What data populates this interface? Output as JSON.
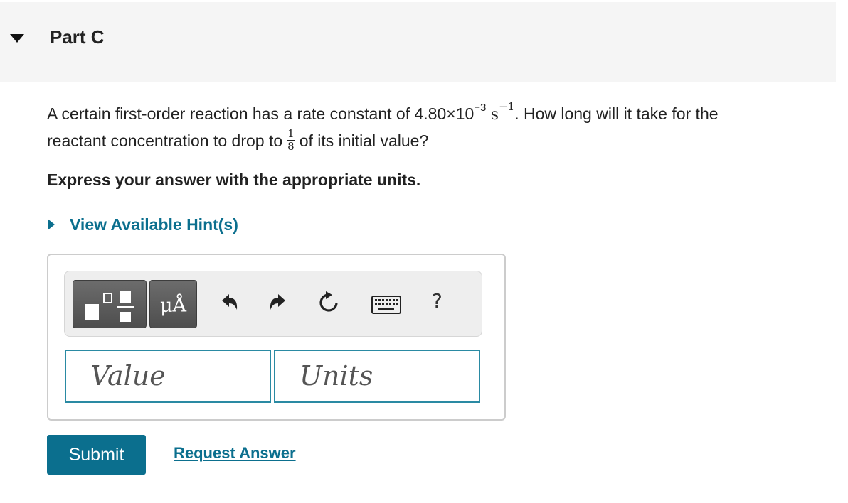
{
  "header": {
    "title": "Part C",
    "toggle_icon": "triangle-down-icon"
  },
  "question": {
    "line1_prefix": "A certain first-order reaction has a rate constant of 4.80×10",
    "exponent": "−3",
    "unit": "s",
    "unit_exponent": "−1",
    "line1_suffix": ". How long will it take for the",
    "line2_prefix": "reactant concentration to drop to",
    "fraction_numerator": "1",
    "fraction_denominator": "8",
    "line2_suffix": "of its initial value?"
  },
  "instruction": "Express your answer with the appropriate units.",
  "hint": {
    "label": "View Available Hint(s)",
    "icon": "triangle-right-icon"
  },
  "toolbar": {
    "templates_icon": "templates-icon",
    "units_label": "μÅ",
    "undo_icon": "undo-icon",
    "redo_icon": "redo-icon",
    "reset_icon": "reset-icon",
    "keyboard_icon": "keyboard-icon",
    "help_label": "?"
  },
  "inputs": {
    "value_placeholder": "Value",
    "units_placeholder": "Units"
  },
  "actions": {
    "submit_label": "Submit",
    "request_label": "Request Answer"
  },
  "colors": {
    "accent": "#0b6f8e",
    "input_border": "#2a8aa3",
    "header_background": "#f5f5f5"
  }
}
